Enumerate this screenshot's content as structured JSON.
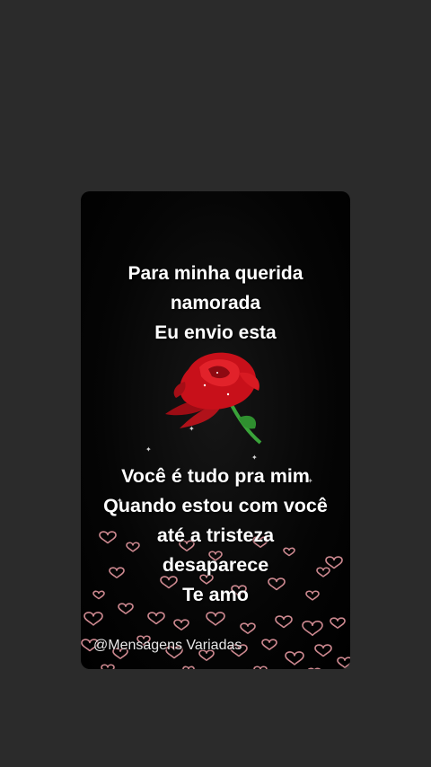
{
  "card": {
    "lines_top": [
      "Para minha querida",
      "namorada",
      "Eu envio esta"
    ],
    "lines_bottom": [
      "Você é tudo pra mim",
      "Quando estou com você",
      "até a tristeza",
      "desaparece",
      "Te amo"
    ],
    "watermark": "@Mensagens Variadas"
  },
  "icons": {
    "rose": "red-rose-icon",
    "hearts": "heart-outline-icon",
    "sparkles": "sparkle-icon"
  },
  "colors": {
    "background": "#2b2b2b",
    "card": "#000000",
    "text": "#ffffff",
    "rose": "#c8101a",
    "heart": "#f0a0a8"
  }
}
